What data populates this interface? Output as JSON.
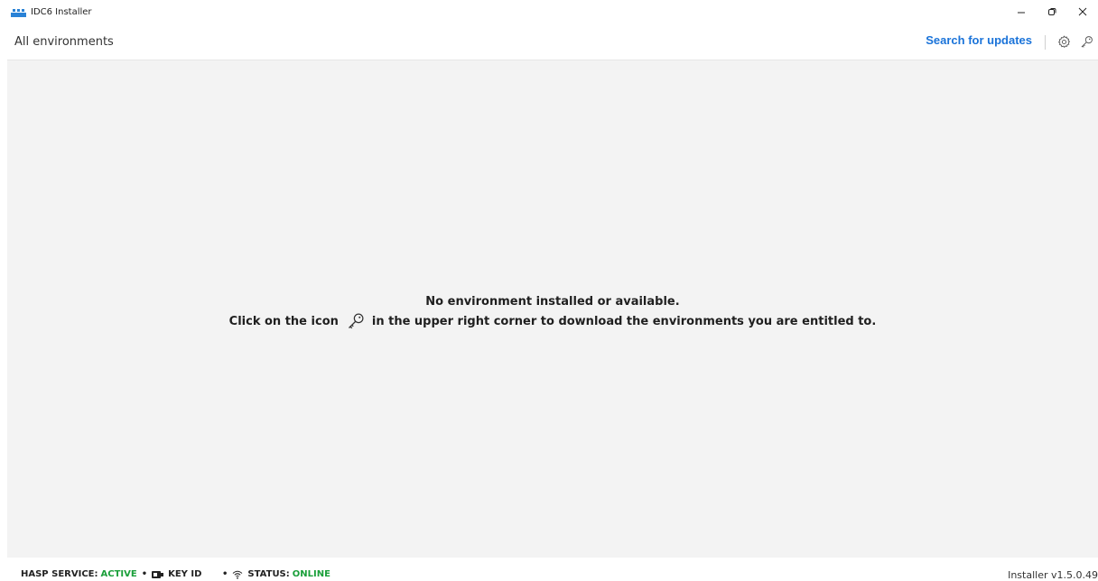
{
  "window": {
    "title": "IDC6 Installer",
    "logo_icon": "app-logo-icon",
    "controls": [
      "minimize-icon",
      "restore-icon",
      "close-icon"
    ]
  },
  "header": {
    "breadcrumb": "All environments",
    "search_updates_label": "Search for updates",
    "accent_color": "#1a73d9",
    "icons": [
      "settings-icon",
      "key-icon"
    ]
  },
  "empty_state": {
    "line1": "No environment installed or available.",
    "line2_before": "Click on the icon",
    "line2_after": "in the upper right corner to download the environments you are entitled to.",
    "inline_icon": "key-icon"
  },
  "footer": {
    "hasp_label": "HASP SERVICE:",
    "hasp_value": "ACTIVE",
    "key_label": "KEY ID",
    "status_label": "STATUS:",
    "status_value": "ONLINE",
    "status_color": "#1a9f3a",
    "version": "Installer v1.5.0.49"
  }
}
